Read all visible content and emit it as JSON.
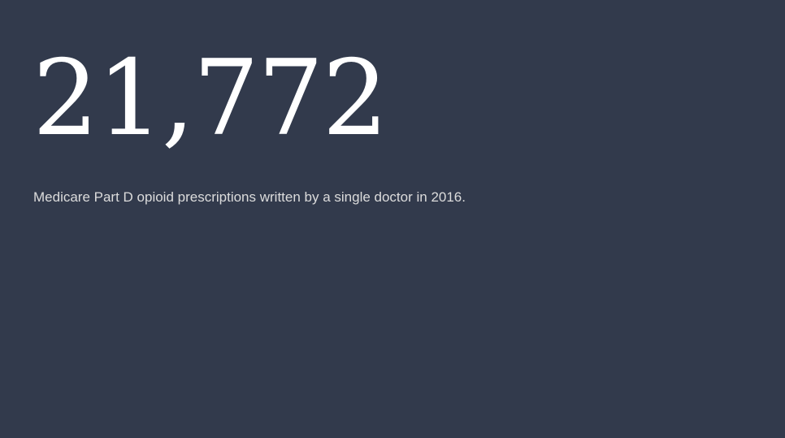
{
  "stat": {
    "value": "21,772",
    "caption": "Medicare Part D opioid prescriptions written by a single doctor in 2016."
  },
  "colors": {
    "background": "#323a4c",
    "number": "#ffffff",
    "caption": "#dcdcdc"
  }
}
